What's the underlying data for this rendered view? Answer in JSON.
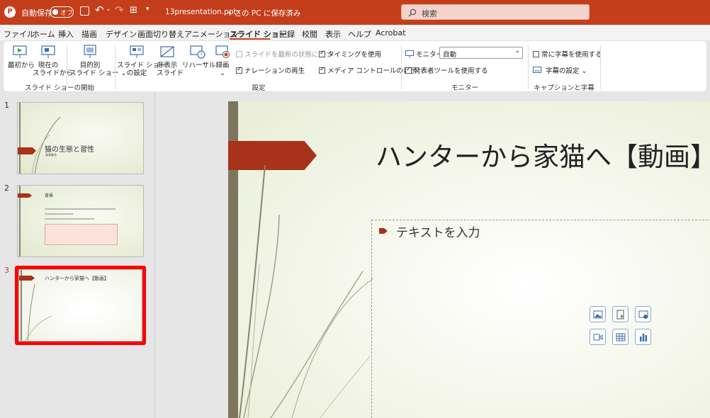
{
  "titlebar": {
    "autosave_label": "自動保存",
    "toggle_label": "オフ",
    "filename": "13presentation.pptx",
    "save_status": "• この PC に保存済み",
    "chevron": "⌄"
  },
  "search": {
    "placeholder": "検索"
  },
  "tabs": [
    "ファイル",
    "ホーム",
    "挿入",
    "描画",
    "デザイン",
    "画面切り替え",
    "アニメーション",
    "スライド ショー",
    "記録",
    "校閲",
    "表示",
    "ヘルプ",
    "Acrobat"
  ],
  "ribbon": {
    "start_group": {
      "label": "スライド ショーの開始",
      "from_beginning": "最初から",
      "from_current_1": "現在の",
      "from_current_2": "スライドから",
      "custom_1": "目的別",
      "custom_2": "スライド ショー ⌄"
    },
    "setup_group": {
      "label": "設定",
      "setup_1": "スライド ショー",
      "setup_2": "の設定",
      "hide_1": "非表示",
      "hide_2": "スライド",
      "rehearse": "リハーサル",
      "record_1": "録画",
      "record_2": "⌄",
      "checks": [
        {
          "label": "スライドを最新の状態に保つ",
          "checked": false,
          "disabled": true
        },
        {
          "label": "ナレーションの再生",
          "checked": true
        },
        {
          "label": "タイミングを使用",
          "checked": true
        },
        {
          "label": "メディア コントロールの表示",
          "checked": true
        }
      ]
    },
    "monitor_group": {
      "label": "モニター",
      "monitor_label": "モニター:",
      "monitor_value": "自動",
      "presenter": "発表者ツールを使用する",
      "presenter_checked": true
    },
    "caption_group": {
      "label": "キャプションと字幕",
      "always_captions": "常に字幕を使用する",
      "always_checked": false,
      "caption_settings": "字幕の設定 ⌄"
    }
  },
  "thumbnails": [
    {
      "num": "1",
      "title": "猫の生態と習性",
      "subtitle": "発表者名"
    },
    {
      "num": "2",
      "title": "背景"
    },
    {
      "num": "3",
      "title": "ハンターから家猫へ【動画】",
      "selected": true
    }
  ],
  "slide": {
    "title": "ハンターから家猫へ【動画】",
    "placeholder": "テキストを入力"
  },
  "colors": {
    "accent": "#c43e1c",
    "arrow": "#a8321a",
    "selection": "#ff0000"
  }
}
